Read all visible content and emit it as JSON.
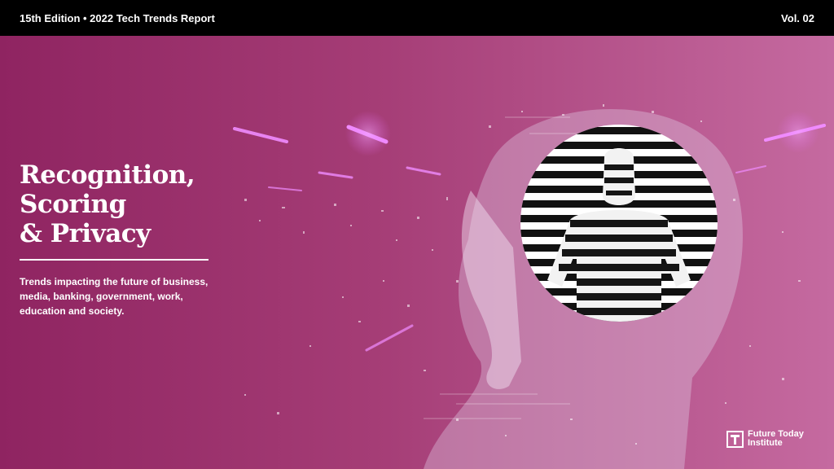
{
  "header": {
    "edition": "15th Edition • 2022 Tech Trends Report",
    "volume": "Vol. 02"
  },
  "cover": {
    "title_lines": [
      "Recognition,",
      "Scoring",
      "& Privacy"
    ],
    "subtitle": "Trends impacting the future of business, media, banking, government, work, education and society."
  },
  "brand": {
    "name_line1": "Future Today",
    "name_line2": "Institute"
  },
  "colors": {
    "background_start": "#8f2461",
    "background_end": "#c56aa0",
    "accent_neon": "#e56cff",
    "text": "#ffffff"
  }
}
